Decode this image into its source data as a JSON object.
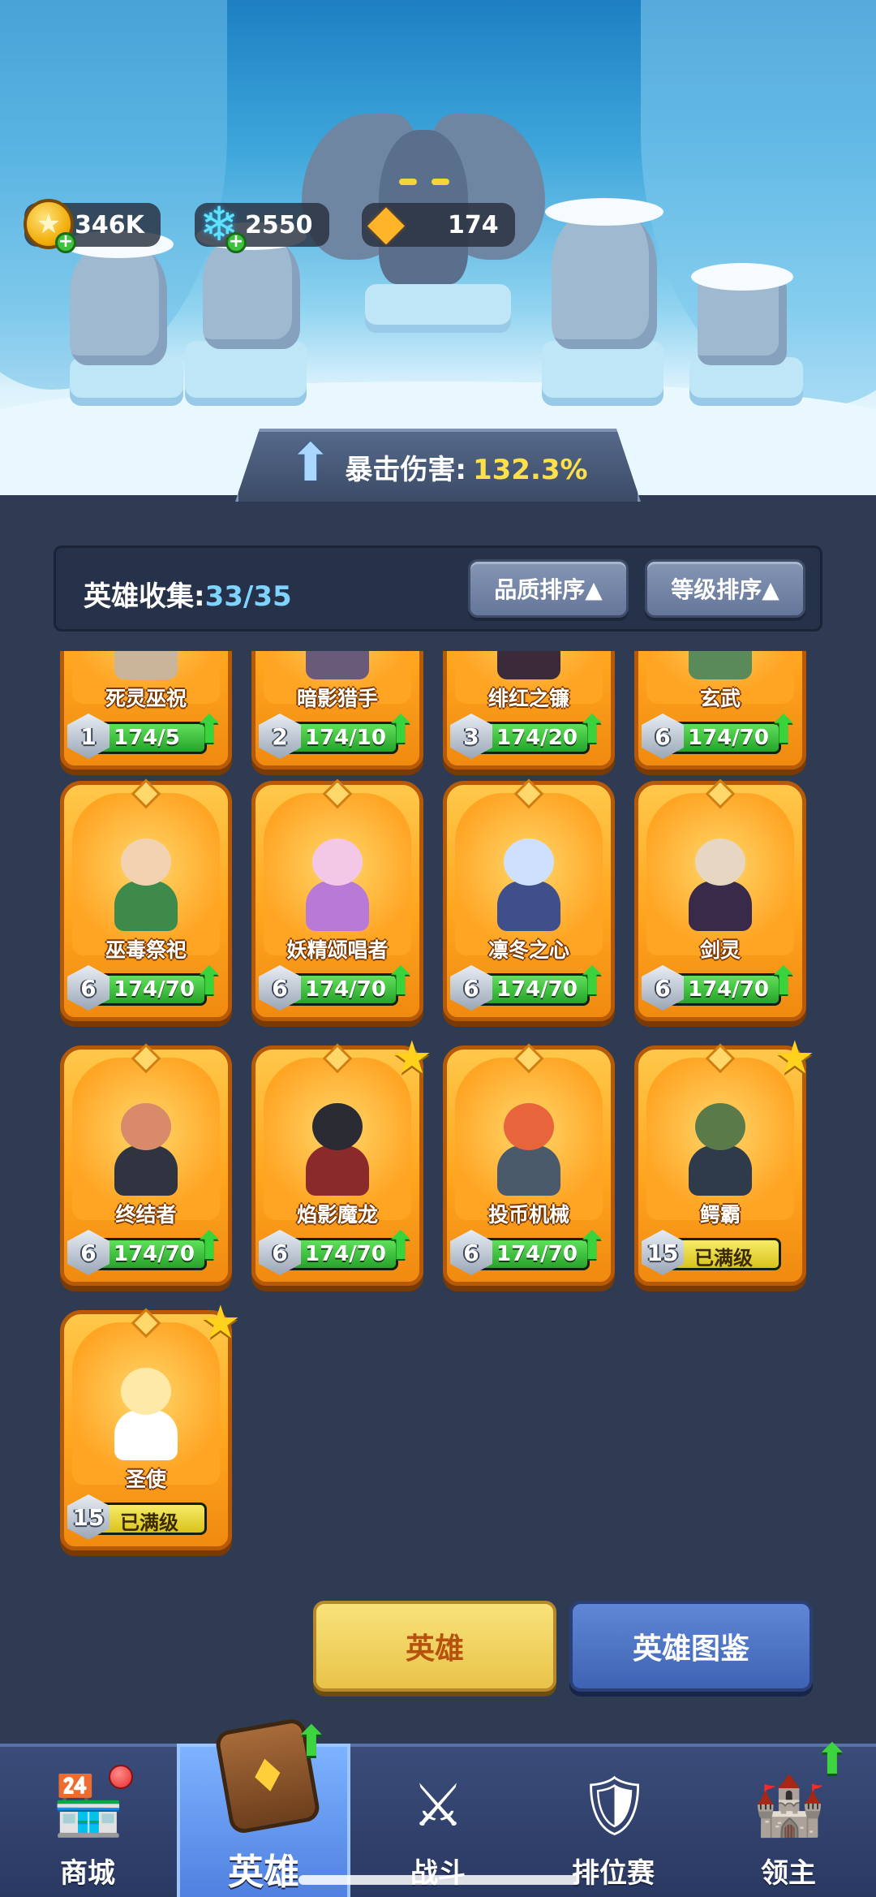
{
  "currencies": {
    "gold": {
      "value": "346K",
      "icon": "gold-coin-icon"
    },
    "gems": {
      "value": "2550",
      "icon": "blue-gem-icon"
    },
    "crystals": {
      "value": "174",
      "icon": "orange-crystal-icon"
    }
  },
  "crit_banner": {
    "label": "暴击伤害:",
    "value": "132.3%"
  },
  "collection": {
    "label": "英雄收集:",
    "count": "33/35"
  },
  "sort_buttons": {
    "quality": "品质排序▲",
    "level": "等级排序▲"
  },
  "heroes": [
    {
      "name": "死灵巫祝",
      "tier": "1",
      "progress": "174/5",
      "upgradable": true,
      "max": false,
      "star": false,
      "colors": [
        "#6d4a8a",
        "#c9b59a"
      ]
    },
    {
      "name": "暗影猎手",
      "tier": "2",
      "progress": "174/10",
      "upgradable": true,
      "max": false,
      "star": false,
      "colors": [
        "#3a3150",
        "#6a5a7a"
      ]
    },
    {
      "name": "绯红之镰",
      "tier": "3",
      "progress": "174/20",
      "upgradable": true,
      "max": false,
      "star": false,
      "colors": [
        "#8a1f2a",
        "#3a2a3a"
      ]
    },
    {
      "name": "玄武",
      "tier": "6",
      "progress": "174/70",
      "upgradable": true,
      "max": false,
      "star": false,
      "colors": [
        "#3c6a4a",
        "#5a8a5a"
      ]
    },
    {
      "name": "巫毒祭祀",
      "tier": "6",
      "progress": "174/70",
      "upgradable": true,
      "max": false,
      "star": false,
      "colors": [
        "#f2d2b0",
        "#3e8a4a"
      ]
    },
    {
      "name": "妖精颂唱者",
      "tier": "6",
      "progress": "174/70",
      "upgradable": true,
      "max": false,
      "star": false,
      "colors": [
        "#f3c7e6",
        "#b87ad6"
      ]
    },
    {
      "name": "凛冬之心",
      "tier": "6",
      "progress": "174/70",
      "upgradable": true,
      "max": false,
      "star": false,
      "colors": [
        "#cfe0ff",
        "#3f4f8a"
      ]
    },
    {
      "name": "剑灵",
      "tier": "6",
      "progress": "174/70",
      "upgradable": true,
      "max": false,
      "star": false,
      "colors": [
        "#e6d6c2",
        "#3a2a4a"
      ]
    },
    {
      "name": "终结者",
      "tier": "6",
      "progress": "174/70",
      "upgradable": true,
      "max": false,
      "star": false,
      "colors": [
        "#d98a6a",
        "#2f3440"
      ]
    },
    {
      "name": "焰影魔龙",
      "tier": "6",
      "progress": "174/70",
      "upgradable": true,
      "max": false,
      "star": true,
      "colors": [
        "#2b2b34",
        "#8a2a2a"
      ]
    },
    {
      "name": "投币机械",
      "tier": "6",
      "progress": "174/70",
      "upgradable": true,
      "max": false,
      "star": false,
      "colors": [
        "#e8643a",
        "#4a5a6a"
      ]
    },
    {
      "name": "鳄霸",
      "tier": "15",
      "progress": "已满级",
      "upgradable": false,
      "max": true,
      "star": true,
      "colors": [
        "#5a7a4a",
        "#2f3a4a"
      ]
    },
    {
      "name": "圣使",
      "tier": "15",
      "progress": "已满级",
      "upgradable": false,
      "max": true,
      "star": true,
      "colors": [
        "#ffe9a8",
        "#ffffff"
      ]
    }
  ],
  "buttons": {
    "hero": "英雄",
    "codex": "英雄图鉴"
  },
  "nav": [
    {
      "label": "商城",
      "icon": "shop-stall-icon"
    },
    {
      "label": "英雄",
      "icon": "hero-card-icon"
    },
    {
      "label": "战斗",
      "icon": "crossed-swords-icon"
    },
    {
      "label": "排位赛",
      "icon": "rank-shield-icon"
    },
    {
      "label": "领主",
      "icon": "lord-banner-icon"
    }
  ]
}
